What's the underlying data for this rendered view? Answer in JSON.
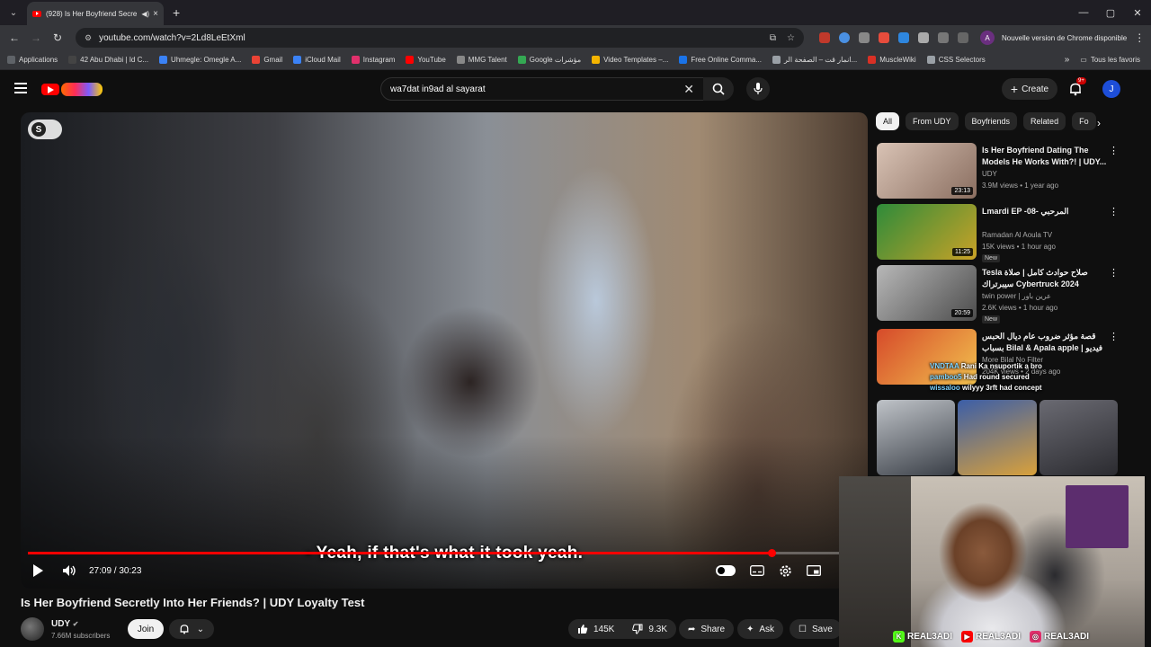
{
  "browser": {
    "tab": {
      "title": "(928) Is Her Boyfriend Secre",
      "audio_icon": "speaker-icon",
      "close": "×"
    },
    "new_tab": "+",
    "window_controls": {
      "minimize": "—",
      "maximize": "▢",
      "close": "✕"
    },
    "nav": {
      "back": "←",
      "forward": "→",
      "reload": "↻"
    },
    "url": "youtube.com/watch?v=2Ld8LeEtXml",
    "profile_initial": "A",
    "update_label": "Nouvelle version de Chrome disponible",
    "menu": "⋮"
  },
  "bookmarks": {
    "items": [
      {
        "label": "Applications",
        "color": "#5f6368"
      },
      {
        "label": "42 Abu Dhabi | Id C...",
        "color": "#444444"
      },
      {
        "label": "Uhmegle: Omegle A...",
        "color": "#3b82f6"
      },
      {
        "label": "Gmail",
        "color": "#ea4335"
      },
      {
        "label": "iCloud Mail",
        "color": "#3b82f6"
      },
      {
        "label": "Instagram",
        "color": "#e1306c"
      },
      {
        "label": "YouTube",
        "color": "#ff0000"
      },
      {
        "label": "MMG Talent",
        "color": "#888888"
      },
      {
        "label": "Google مؤشرات",
        "color": "#34a853"
      },
      {
        "label": "Video Templates –...",
        "color": "#f4b400"
      },
      {
        "label": "Free Online Comma...",
        "color": "#1a73e8"
      },
      {
        "label": "انمار قت – الصفحة الر...",
        "color": "#9aa0a6"
      },
      {
        "label": "MuscleWiki",
        "color": "#d93025"
      },
      {
        "label": "CSS Selectors",
        "color": "#9aa0a6"
      }
    ],
    "more": "»",
    "all_label": "Tous les favoris"
  },
  "youtube": {
    "search_query": "wa7dat in9ad al sayarat",
    "create_label": "Create",
    "notif_count": "9+",
    "account_initial": "J"
  },
  "player": {
    "caption": "- Yeah, if that's what it took yeah.",
    "current_time": "27:09",
    "duration": "30:23",
    "time_display": "27:09 / 30:23",
    "progress_fraction": 0.893,
    "buffer_fraction": 0.915
  },
  "video": {
    "title": "Is Her Boyfriend Secretly Into Her Friends? | UDY Loyalty Test",
    "channel": "UDY",
    "subscribers": "7.66M subscribers",
    "join_label": "Join",
    "likes": "145K",
    "dislikes": "9.3K",
    "share_label": "Share",
    "ask_label": "Ask",
    "save_label": "Save"
  },
  "sidebar": {
    "chips": [
      "All",
      "From UDY",
      "Boyfriends",
      "Related",
      "Fo"
    ],
    "recommendations": [
      {
        "title": "Is Her Boyfriend Dating The Models He Works With?! | UDY...",
        "channel": "UDY",
        "meta": "3.9M views • 1 year ago",
        "duration": "23:13",
        "is_new": false,
        "colors": [
          "#d9c3b5",
          "#8a6e60"
        ]
      },
      {
        "title": "Lmardi EP -08- المرحبي",
        "channel": "Ramadan Al Aoula TV",
        "meta": "15K views • 1 hour ago",
        "duration": "11:25",
        "is_new": true,
        "colors": [
          "#2e8b3a",
          "#c9a227"
        ]
      },
      {
        "title": "Tesla صلاح حوادث كامل | صلاة سيبرتراك Cybertruck 2024",
        "channel": "twin power | عرين باور",
        "meta": "2.6K views • 1 hour ago",
        "duration": "20:59",
        "is_new": true,
        "colors": [
          "#b8b8b8",
          "#4c4c4c"
        ]
      },
      {
        "title": "قصة مؤثر ضروب عام ديال الحبس بسباب Bilal & Apala apple | فيديو فالستغرام",
        "channel": "More Bilal No Filter",
        "meta": "204K views • 2 days ago",
        "duration": "",
        "is_new": false,
        "colors": [
          "#d64a2a",
          "#f2c14e"
        ]
      }
    ],
    "new_label": "New",
    "menu": "⋮",
    "next": "›"
  },
  "chat": [
    {
      "user": "VNDTAA",
      "msg": "Rani Ka nsuportik a bro"
    },
    {
      "user": "pamboo5",
      "msg": "Had round secured"
    },
    {
      "user": "wissaloo",
      "msg": "wilyyy 3rft had concept"
    }
  ],
  "socials": [
    {
      "icon": "kick-icon",
      "handle": "REAL3ADI",
      "color": "#53fc18",
      "glyph": "K"
    },
    {
      "icon": "youtube-icon",
      "handle": "REAL3ADI",
      "color": "#ff0000",
      "glyph": "▶"
    },
    {
      "icon": "instagram-icon",
      "handle": "REAL3ADI",
      "color": "#e1306c",
      "glyph": "◎"
    }
  ]
}
